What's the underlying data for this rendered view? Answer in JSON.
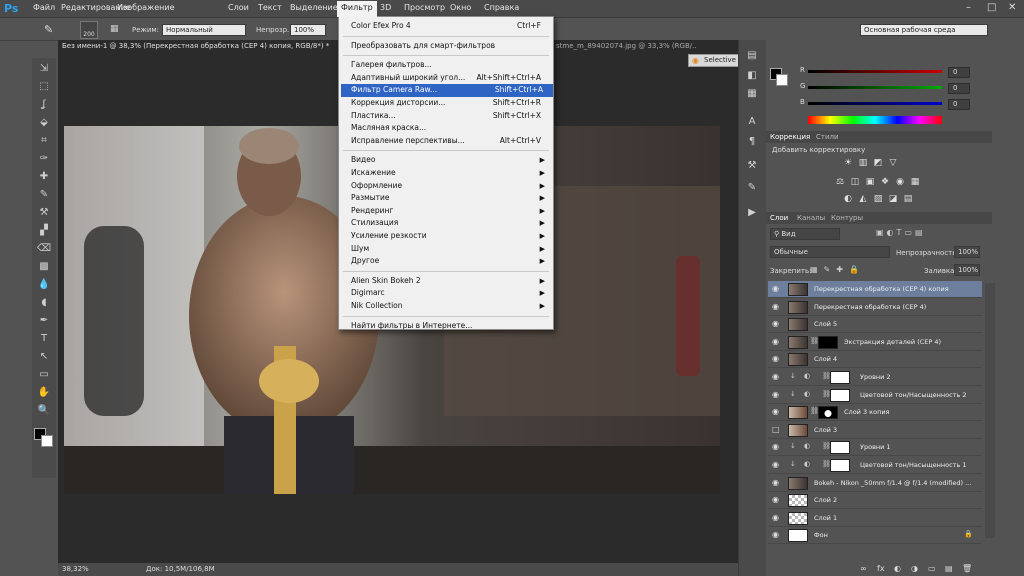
{
  "app": {
    "logo": "Ps"
  },
  "menubar": {
    "items": [
      "Файл",
      "Редактирование",
      "Изображение",
      "Слои",
      "Текст",
      "Выделение",
      "Фильтр",
      "3D",
      "Просмотр",
      "Окно",
      "Справка"
    ],
    "active": "Фильтр",
    "window_controls": [
      "–",
      "□",
      "✕"
    ]
  },
  "options_bar": {
    "brush_size": "200",
    "mode_label": "Режим:",
    "mode_value": "Нормальный",
    "opacity_label": "Непрозр.:",
    "opacity_value": "100%",
    "workspace": "Основная рабочая среда"
  },
  "documents": {
    "active_tab": "Без имени-1 @ 38,3% (Перекрестная обработка (CEP 4) копия, RGB/8*) *",
    "other_tab": "stme_m_89402074.jpg @ 33,3% (RGB/..."
  },
  "status_bar": {
    "zoom": "38,32%",
    "doc_info": "Док: 10,5M/106,8M"
  },
  "filter_menu": {
    "items": [
      {
        "label": "Color Efex Pro 4",
        "shortcut": "Ctrl+F"
      },
      {
        "sep": true
      },
      {
        "label": "Преобразовать для смарт-фильтров"
      },
      {
        "sep": true
      },
      {
        "label": "Галерея фильтров..."
      },
      {
        "label": "Адаптивный широкий угол...",
        "shortcut": "Alt+Shift+Ctrl+A"
      },
      {
        "label": "Фильтр Camera Raw...",
        "shortcut": "Shift+Ctrl+A",
        "highlight": true
      },
      {
        "label": "Коррекция дисторсии...",
        "shortcut": "Shift+Ctrl+R"
      },
      {
        "label": "Пластика...",
        "shortcut": "Shift+Ctrl+X"
      },
      {
        "label": "Масляная краска..."
      },
      {
        "label": "Исправление перспективы...",
        "shortcut": "Alt+Ctrl+V"
      },
      {
        "sep": true
      },
      {
        "label": "Видео",
        "submenu": true
      },
      {
        "label": "Искажение",
        "submenu": true
      },
      {
        "label": "Оформление",
        "submenu": true
      },
      {
        "label": "Размытие",
        "submenu": true
      },
      {
        "label": "Рендеринг",
        "submenu": true
      },
      {
        "label": "Стилизация",
        "submenu": true
      },
      {
        "label": "Усиление резкости",
        "submenu": true
      },
      {
        "label": "Шум",
        "submenu": true
      },
      {
        "label": "Другое",
        "submenu": true
      },
      {
        "sep": true
      },
      {
        "label": "Alien Skin Bokeh 2",
        "submenu": true
      },
      {
        "label": "Digimarc",
        "submenu": true
      },
      {
        "label": "Nik Collection",
        "submenu": true
      },
      {
        "sep": true
      },
      {
        "label": "Найти фильтры в Интернете..."
      }
    ]
  },
  "selective_tool": {
    "title": "Selective Tool"
  },
  "color_panel": {
    "channels": [
      {
        "label": "R",
        "value": "0"
      },
      {
        "label": "G",
        "value": "0"
      },
      {
        "label": "B",
        "value": "0"
      }
    ]
  },
  "adjustments_panel": {
    "tabs": [
      "Коррекция",
      "Стили"
    ],
    "title": "Добавить корректировку",
    "row1_icons": [
      "☀",
      "▥",
      "◩",
      "▽"
    ],
    "row2_icons": [
      "⚖",
      "◫",
      "▣",
      "❖",
      "◉",
      "▦"
    ],
    "row3_icons": [
      "◐",
      "◭",
      "▨",
      "◪",
      "▤"
    ]
  },
  "layers_panel": {
    "tabs": [
      "Слои",
      "Каналы",
      "Контуры"
    ],
    "filter_kind": "Вид",
    "blend_mode": "Обычные",
    "opacity_label": "Непрозрачность:",
    "opacity_value": "100%",
    "lock_label": "Закрепить:",
    "fill_label": "Заливка:",
    "fill_value": "100%",
    "layers": [
      {
        "name": "Перекрестная обработка (CEP 4) копия",
        "visible": true,
        "selected": true,
        "thumb": "photo"
      },
      {
        "name": "Перекрестная обработка (CEP 4)",
        "visible": true,
        "thumb": "photo"
      },
      {
        "name": "Слой 5",
        "visible": true,
        "thumb": "photo"
      },
      {
        "name": "Экстракция деталей (CEP 4)",
        "visible": true,
        "thumb": "photo",
        "mask": "black"
      },
      {
        "name": "Слой 4",
        "visible": true,
        "thumb": "photo"
      },
      {
        "name": "Уровни 2",
        "visible": true,
        "thumb": "adj",
        "mask": "white",
        "clipped": true
      },
      {
        "name": "Цветовой тон/Насыщенность 2",
        "visible": true,
        "thumb": "adj",
        "mask": "white",
        "clipped": true
      },
      {
        "name": "Слой 3 копия",
        "visible": true,
        "thumb": "photo2",
        "mask": "silhouette"
      },
      {
        "name": "Слой 3",
        "visible": false,
        "thumb": "photo2"
      },
      {
        "name": "Уровни 1",
        "visible": true,
        "thumb": "adj",
        "mask": "white",
        "clipped": true
      },
      {
        "name": "Цветовой тон/Насыщенность 1",
        "visible": true,
        "thumb": "adj",
        "mask": "white",
        "clipped": true
      },
      {
        "name": "Bokeh - Nikon _50mm f/1.4 @ f/1.4 (modified) ...",
        "visible": true,
        "thumb": "photo"
      },
      {
        "name": "Слой 2",
        "visible": true,
        "thumb": "trans"
      },
      {
        "name": "Слой 1",
        "visible": true,
        "thumb": "trans"
      },
      {
        "name": "Фон",
        "visible": true,
        "thumb": "white",
        "locked": true
      }
    ],
    "footer_icons": [
      "∞",
      "fx",
      "◐",
      "◑",
      "▭",
      "▤",
      "🗑"
    ]
  },
  "tools": [
    "⇲",
    "⬚",
    "ʆ",
    "⬙",
    "⌗",
    "✑",
    "✚",
    "✎",
    "⚒",
    "▞",
    "⌫",
    "▩",
    "💧",
    "◖",
    "✒",
    "T",
    "↖",
    "▭",
    "✋",
    "🔍"
  ],
  "strip_icons": [
    "▤",
    "◧",
    "▦",
    "A",
    "¶",
    "⚒",
    "✎",
    "▶"
  ],
  "colors": {
    "accent": "#2f63c4",
    "panel": "#535353",
    "dark": "#2b2b2b"
  }
}
